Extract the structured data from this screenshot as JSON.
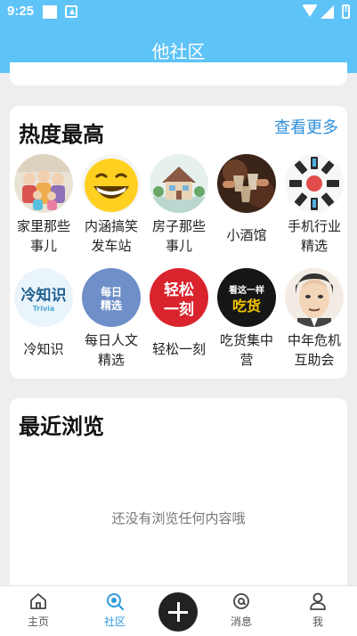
{
  "status_bar": {
    "time": "9:25"
  },
  "header": {
    "title": "他社区"
  },
  "hot": {
    "title": "热度最高",
    "more_label": "查看更多",
    "items": [
      {
        "line1": "家里那些",
        "line2": "事儿",
        "icon": "family-photo"
      },
      {
        "line1": "内涵搞笑",
        "line2": "发车站",
        "icon": "laughing-emoji"
      },
      {
        "line1": "房子那些",
        "line2": "事儿",
        "icon": "house-illustration"
      },
      {
        "line1": "小酒馆",
        "line2": "",
        "icon": "toasting-glasses"
      },
      {
        "line1": "手机行业",
        "line2": "精选",
        "icon": "phones-circle"
      },
      {
        "line1": "冷知识",
        "line2": "",
        "icon": "trivia-logo"
      },
      {
        "line1": "每日人文",
        "line2": "精选",
        "icon": "daily-picks-logo"
      },
      {
        "line1": "轻松一刻",
        "line2": "",
        "icon": "relax-logo"
      },
      {
        "line1": "吃货集中",
        "line2": "营",
        "icon": "foodie-logo"
      },
      {
        "line1": "中年危机",
        "line2": "互助会",
        "icon": "cartoon-man"
      }
    ],
    "logo_texts": {
      "trivia_main": "冷知识",
      "trivia_sub": "Trivia",
      "daily_line1": "每日",
      "daily_line2": "精选",
      "relax_line1": "轻松",
      "relax_line2": "一刻",
      "food_line1": "看这一样",
      "food_line2": "吃货"
    }
  },
  "recent": {
    "title": "最近浏览",
    "empty_text": "还没有浏览任何内容哦"
  },
  "nav": {
    "home": "主页",
    "community": "社区",
    "messages": "消息",
    "me": "我"
  },
  "colors": {
    "header": "#5ec3f7",
    "accent": "#2f9ae0"
  }
}
